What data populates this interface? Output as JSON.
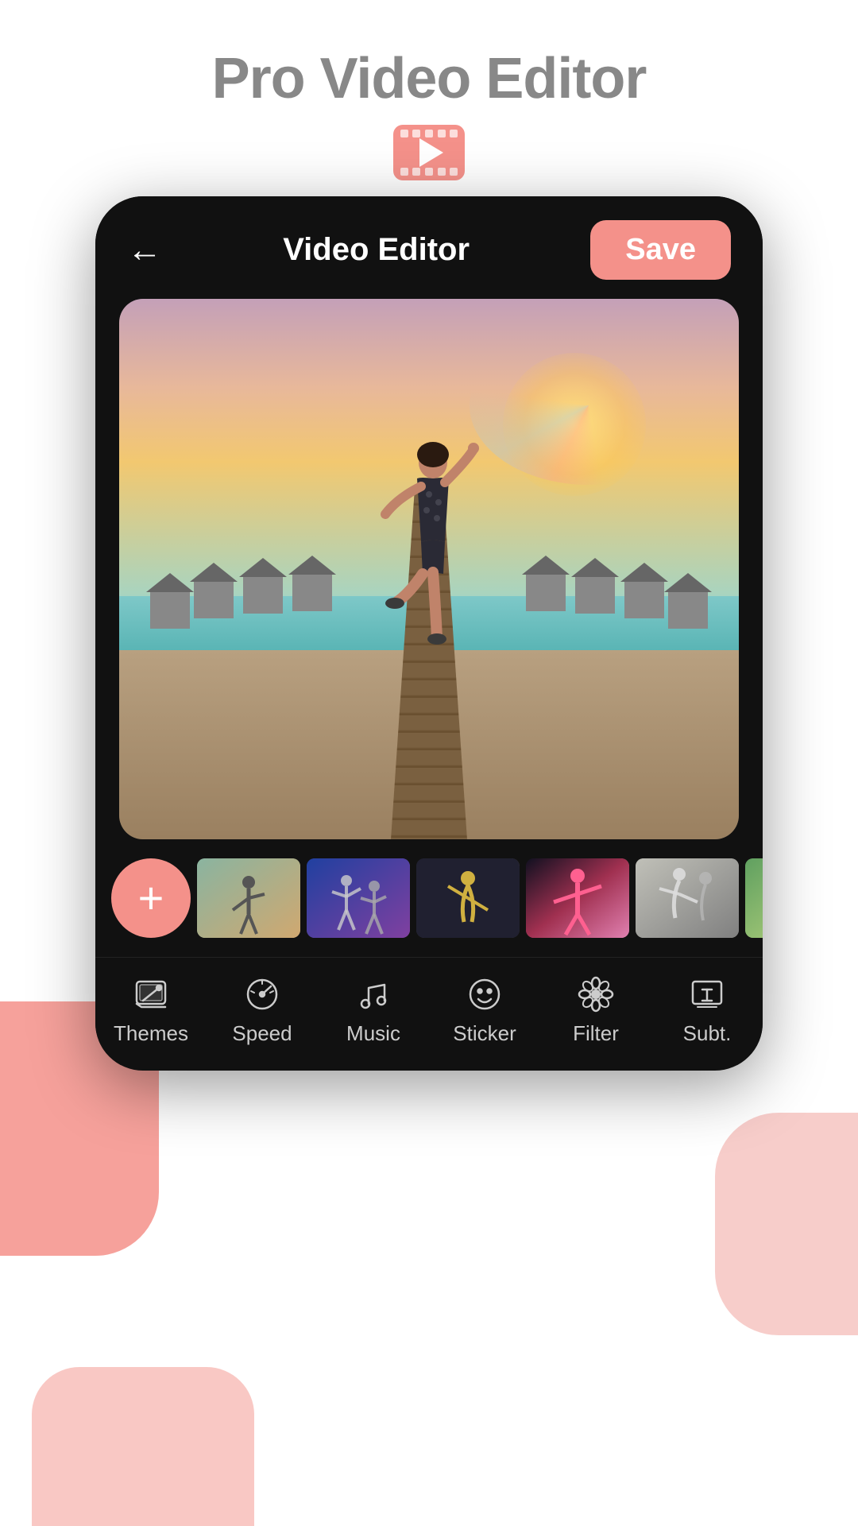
{
  "app": {
    "title": "Pro Video Editor",
    "icon_alt": "video-play-icon"
  },
  "screen": {
    "title": "Video Editor",
    "back_label": "←",
    "save_label": "Save"
  },
  "thumbnail_strip": {
    "add_button_label": "+",
    "thumbnails": [
      {
        "id": 1,
        "alt": "beach dance clip"
      },
      {
        "id": 2,
        "alt": "concert dance clip"
      },
      {
        "id": 3,
        "alt": "solo dancer clip"
      },
      {
        "id": 4,
        "alt": "colorful dance clip"
      },
      {
        "id": 5,
        "alt": "acrobat clip"
      },
      {
        "id": 6,
        "alt": "outdoor dance clip"
      }
    ]
  },
  "bottom_nav": {
    "items": [
      {
        "id": "themes",
        "label": "Themes",
        "icon": "themes-icon"
      },
      {
        "id": "speed",
        "label": "Speed",
        "icon": "speed-icon"
      },
      {
        "id": "music",
        "label": "Music",
        "icon": "music-icon"
      },
      {
        "id": "sticker",
        "label": "Sticker",
        "icon": "sticker-icon"
      },
      {
        "id": "filter",
        "label": "Filter",
        "icon": "filter-icon"
      },
      {
        "id": "subtitle",
        "label": "Subt.",
        "icon": "subtitle-icon"
      }
    ]
  },
  "colors": {
    "accent": "#f4918a",
    "background_dark": "#111111",
    "text_light": "#cccccc",
    "text_white": "#ffffff"
  }
}
